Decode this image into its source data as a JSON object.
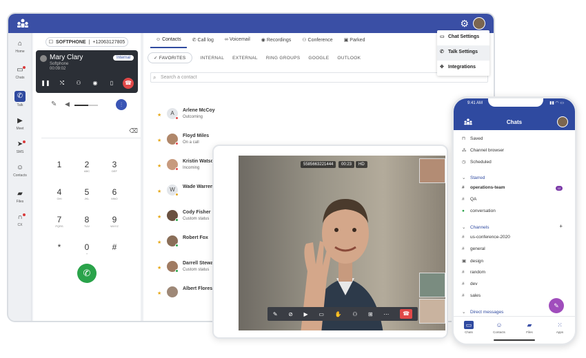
{
  "softphone": {
    "label": "SOFTPHONE",
    "number": "+12063127805",
    "caller_name": "Mary Clary",
    "caller_sub": "Softphone",
    "timer": "00:09:02",
    "badge": "Internal"
  },
  "sidenav": [
    {
      "label": "Home",
      "icon": "home-icon",
      "glyph": "⌂"
    },
    {
      "label": "Chats",
      "icon": "chat-icon",
      "glyph": "▭"
    },
    {
      "label": "Talk",
      "icon": "phone-icon",
      "glyph": "✆"
    },
    {
      "label": "Meet",
      "icon": "video-icon",
      "glyph": "▶"
    },
    {
      "label": "SMS",
      "icon": "send-icon",
      "glyph": "➤"
    },
    {
      "label": "Contacts",
      "icon": "contacts-icon",
      "glyph": "☺"
    },
    {
      "label": "Files",
      "icon": "folder-icon",
      "glyph": "▰"
    },
    {
      "label": "CX",
      "icon": "headset-icon",
      "glyph": "∩"
    }
  ],
  "keypad": [
    {
      "d": "1",
      "l": ""
    },
    {
      "d": "2",
      "l": "ABC"
    },
    {
      "d": "3",
      "l": "DEF"
    },
    {
      "d": "4",
      "l": "GHI"
    },
    {
      "d": "5",
      "l": "JKL"
    },
    {
      "d": "6",
      "l": "MNO"
    },
    {
      "d": "7",
      "l": "PQRS"
    },
    {
      "d": "8",
      "l": "TUV"
    },
    {
      "d": "9",
      "l": "WXYZ"
    },
    {
      "d": "*",
      "l": ""
    },
    {
      "d": "0",
      "l": "+"
    },
    {
      "d": "#",
      "l": ""
    }
  ],
  "tabs": [
    "Contacts",
    "Call log",
    "Voicemail",
    "Recordings",
    "Conference",
    "Parked"
  ],
  "filters": [
    "FAVORITES",
    "INTERNAL",
    "EXTERNAL",
    "RING GROUPS",
    "GOOGLE",
    "OUTLOOK"
  ],
  "search_placeholder": "Search a contact",
  "contacts": [
    {
      "name": "Arlene McCoy",
      "status": "Outcoming",
      "avatar": "A",
      "dot": "#e04848"
    },
    {
      "name": "Floyd Miles",
      "status": "On a call",
      "avatar": "",
      "dot": "#e04848"
    },
    {
      "name": "Kristin Watson",
      "status": "Incoming",
      "avatar": "",
      "dot": "#e04848"
    },
    {
      "name": "Wade Warren",
      "status": "",
      "avatar": "W",
      "dot": "#e6a817"
    },
    {
      "name": "Cody Fisher",
      "status": "Custom status",
      "avatar": "",
      "dot": "#2aa34a"
    },
    {
      "name": "Robert Fox",
      "status": "",
      "avatar": "",
      "dot": "#2aa34a"
    },
    {
      "name": "Darrell Steward",
      "status": "Custom status",
      "avatar": "",
      "dot": "#2aa34a"
    },
    {
      "name": "Albert Flores",
      "status": "",
      "avatar": "",
      "dot": ""
    }
  ],
  "settings_menu": [
    "Chat Settings",
    "Talk Settings",
    "Integrations"
  ],
  "video": {
    "number": "5585663221444",
    "duration": "00:23",
    "quality": "HD"
  },
  "phone": {
    "time": "9:41 AM",
    "title": "Chats",
    "top_items": [
      "Saved",
      "Channel browser",
      "Scheduled"
    ],
    "starred_label": "Starred",
    "starred": [
      "operations-team",
      "QA",
      "conversation"
    ],
    "starred_badge": "12",
    "channels_label": "Channels",
    "channels": [
      "us-conference-2020",
      "general",
      "design",
      "random",
      "dev",
      "sales"
    ],
    "dm_label": "Direct messages",
    "bottom": [
      "Chats",
      "Contacts",
      "Files",
      "Apps"
    ]
  }
}
